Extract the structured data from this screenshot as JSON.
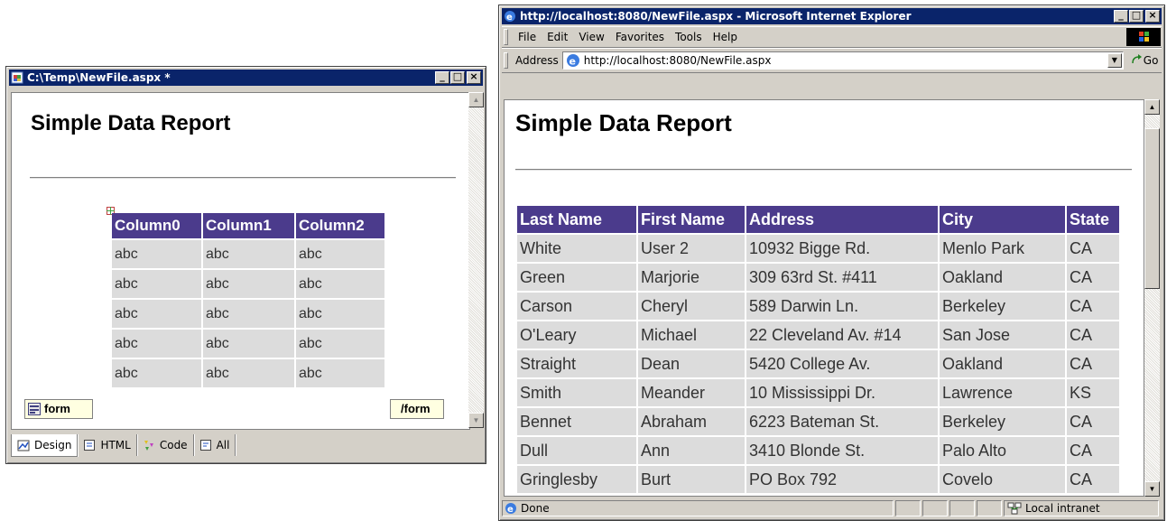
{
  "designer": {
    "title": "C:\\Temp\\NewFile.aspx *",
    "heading": "Simple Data Report",
    "columns": [
      "Column0",
      "Column1",
      "Column2"
    ],
    "rows": [
      [
        "abc",
        "abc",
        "abc"
      ],
      [
        "abc",
        "abc",
        "abc"
      ],
      [
        "abc",
        "abc",
        "abc"
      ],
      [
        "abc",
        "abc",
        "abc"
      ],
      [
        "abc",
        "abc",
        "abc"
      ]
    ],
    "form_open_tag": "form",
    "form_close_tag": "/form",
    "tabs": [
      "Design",
      "HTML",
      "Code",
      "All"
    ],
    "active_tab": "Design"
  },
  "browser": {
    "title": "http://localhost:8080/NewFile.aspx - Microsoft Internet Explorer",
    "menu": [
      "File",
      "Edit",
      "View",
      "Favorites",
      "Tools",
      "Help"
    ],
    "address_label": "Address",
    "address_value": "http://localhost:8080/NewFile.aspx",
    "go_label": "Go",
    "heading": "Simple Data Report",
    "columns": [
      "Last Name",
      "First Name",
      "Address",
      "City",
      "State"
    ],
    "rows": [
      [
        "White",
        "User 2",
        "10932 Bigge Rd.",
        "Menlo Park",
        "CA"
      ],
      [
        "Green",
        "Marjorie",
        "309 63rd St. #411",
        "Oakland",
        "CA"
      ],
      [
        "Carson",
        "Cheryl",
        "589 Darwin Ln.",
        "Berkeley",
        "CA"
      ],
      [
        "O'Leary",
        "Michael",
        "22 Cleveland Av. #14",
        "San Jose",
        "CA"
      ],
      [
        "Straight",
        "Dean",
        "5420 College Av.",
        "Oakland",
        "CA"
      ],
      [
        "Smith",
        "Meander",
        "10 Mississippi Dr.",
        "Lawrence",
        "KS"
      ],
      [
        "Bennet",
        "Abraham",
        "6223 Bateman St.",
        "Berkeley",
        "CA"
      ],
      [
        "Dull",
        "Ann",
        "3410 Blonde St.",
        "Palo Alto",
        "CA"
      ],
      [
        "Gringlesby",
        "Burt",
        "PO Box 792",
        "Covelo",
        "CA"
      ]
    ],
    "status_text": "Done",
    "zone_text": "Local intranet"
  },
  "colors": {
    "titlebar": "#0a246a",
    "table_header": "#4b3b8c",
    "table_cell": "#dcdcdc",
    "chrome": "#d4d0c8"
  },
  "icons": [
    "document-icon",
    "form-tag-icon",
    "design-icon",
    "html-icon",
    "code-icon",
    "all-icon",
    "ie-page-icon",
    "go-arrow-icon",
    "windows-logo-icon",
    "intranet-icon"
  ]
}
